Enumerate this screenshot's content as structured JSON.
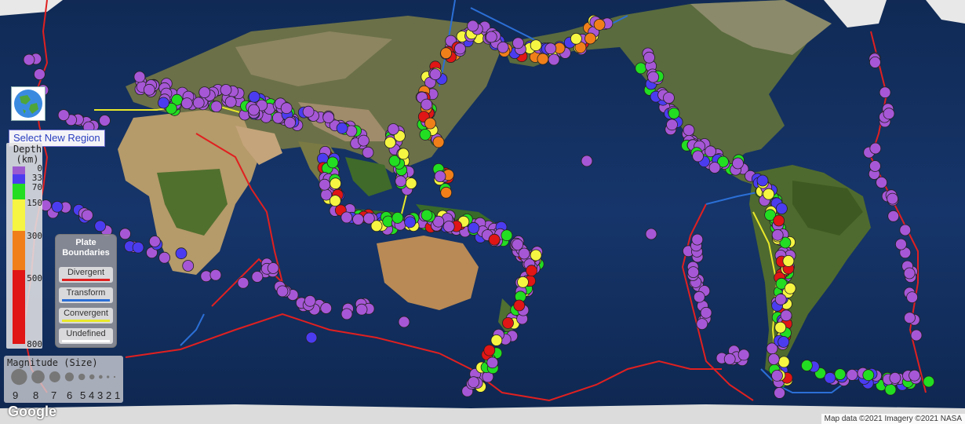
{
  "select_region_label": "Select New Region",
  "depth_legend": {
    "title_line1": "Depth",
    "title_line2": "(km)",
    "ticks": [
      "0",
      "33",
      "70",
      "150",
      "300",
      "500",
      "800"
    ],
    "colors": [
      "#9b59d0",
      "#4b3cf0",
      "#22dd22",
      "#f5f542",
      "#f07f1a",
      "#e01515"
    ]
  },
  "plate_legend": {
    "title_line1": "Plate",
    "title_line2": "Boundaries",
    "items": [
      {
        "label": "Divergent",
        "color": "#e02020"
      },
      {
        "label": "Transform",
        "color": "#2b6fd6"
      },
      {
        "label": "Convergent",
        "color": "#e8e82a"
      },
      {
        "label": "Undefined",
        "color": "#ffffff"
      }
    ]
  },
  "magnitude_legend": {
    "title": "Magnitude (Size)",
    "numbers": [
      "9",
      "8",
      "7",
      "6",
      "5",
      "4",
      "3",
      "2",
      "1"
    ]
  },
  "google_logo": "Google",
  "attribution": "Map data ©2021 Imagery ©2021 NASA",
  "quake_colors": {
    "shallow": "#a657d6",
    "mid": "#4b3cf0",
    "deep70": "#22dd22",
    "deep150": "#f5f542",
    "deep300": "#f07f1a",
    "deep500": "#e01515"
  },
  "globe_icon": "globe-icon"
}
